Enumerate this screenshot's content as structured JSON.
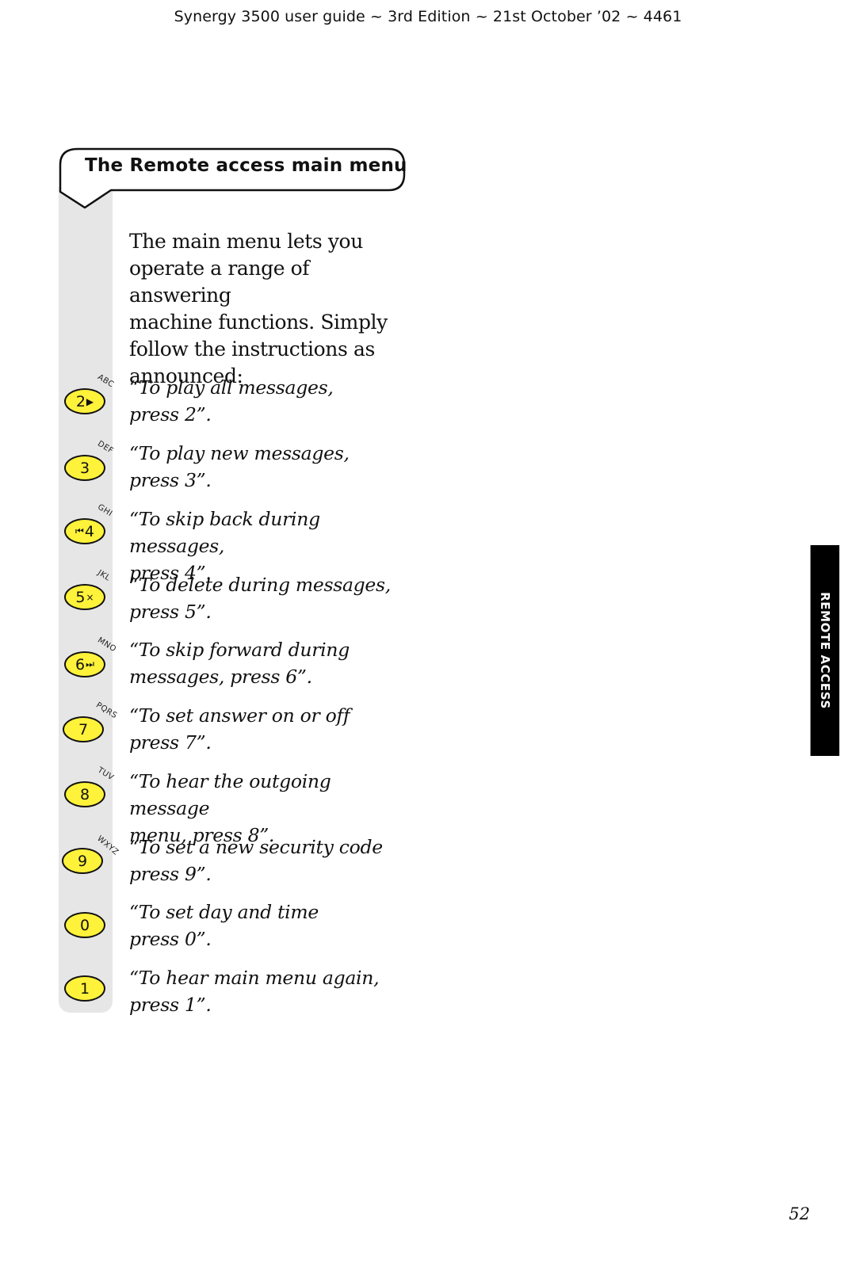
{
  "header": {
    "running_title": "Synergy 3500 user guide ~ 3rd Edition ~ 21st October ’02 ~ 4461"
  },
  "section": {
    "title": "The Remote access main menu",
    "intro_lines": [
      "The main menu lets you",
      "operate a range of answering",
      "machine functions. Simply",
      "follow the instructions as",
      "announced:"
    ]
  },
  "options": [
    {
      "key": "2",
      "letters": "ABC",
      "icon": "play-icon",
      "line1": "“To play all messages,",
      "line2": "press 2”."
    },
    {
      "key": "3",
      "letters": "DEF",
      "icon": "",
      "line1": "“To play new messages,",
      "line2": "press 3”."
    },
    {
      "key": "4",
      "letters": "GHI",
      "icon": "skip-back-icon",
      "line1": "“To skip back during messages,",
      "line2": "press 4”."
    },
    {
      "key": "5",
      "letters": "JKL",
      "icon": "delete-icon",
      "line1": "“To delete during messages,",
      "line2": "press 5”."
    },
    {
      "key": "6",
      "letters": "MNO",
      "icon": "skip-forward-icon",
      "line1": "“To skip forward during",
      "line2": "messages, press 6”."
    },
    {
      "key": "7",
      "letters": "PQRS",
      "icon": "",
      "line1": "“To set answer on or off",
      "line2": "press 7”."
    },
    {
      "key": "8",
      "letters": "TUV",
      "icon": "",
      "line1": "“To hear the outgoing message",
      "line2": "menu, press 8”."
    },
    {
      "key": "9",
      "letters": "WXYZ",
      "icon": "",
      "line1": "“To set a new security code",
      "line2": "press 9”."
    },
    {
      "key": "0",
      "letters": "",
      "icon": "",
      "line1": "“To set day and time",
      "line2": "press 0”."
    },
    {
      "key": "1",
      "letters": "",
      "icon": "",
      "line1": "“To hear main menu again,",
      "line2": "press 1”."
    }
  ],
  "glyphs": {
    "play": "▶",
    "skip_back": "⏮",
    "delete": "×",
    "skip_forward": "⏭"
  },
  "side_tab": {
    "label": "REMOTE ACCESS"
  },
  "colors": {
    "key_fill": "#fff23a",
    "strip": "#e6e6e6",
    "tab": "#000000"
  },
  "footer": {
    "page_number": "52"
  }
}
